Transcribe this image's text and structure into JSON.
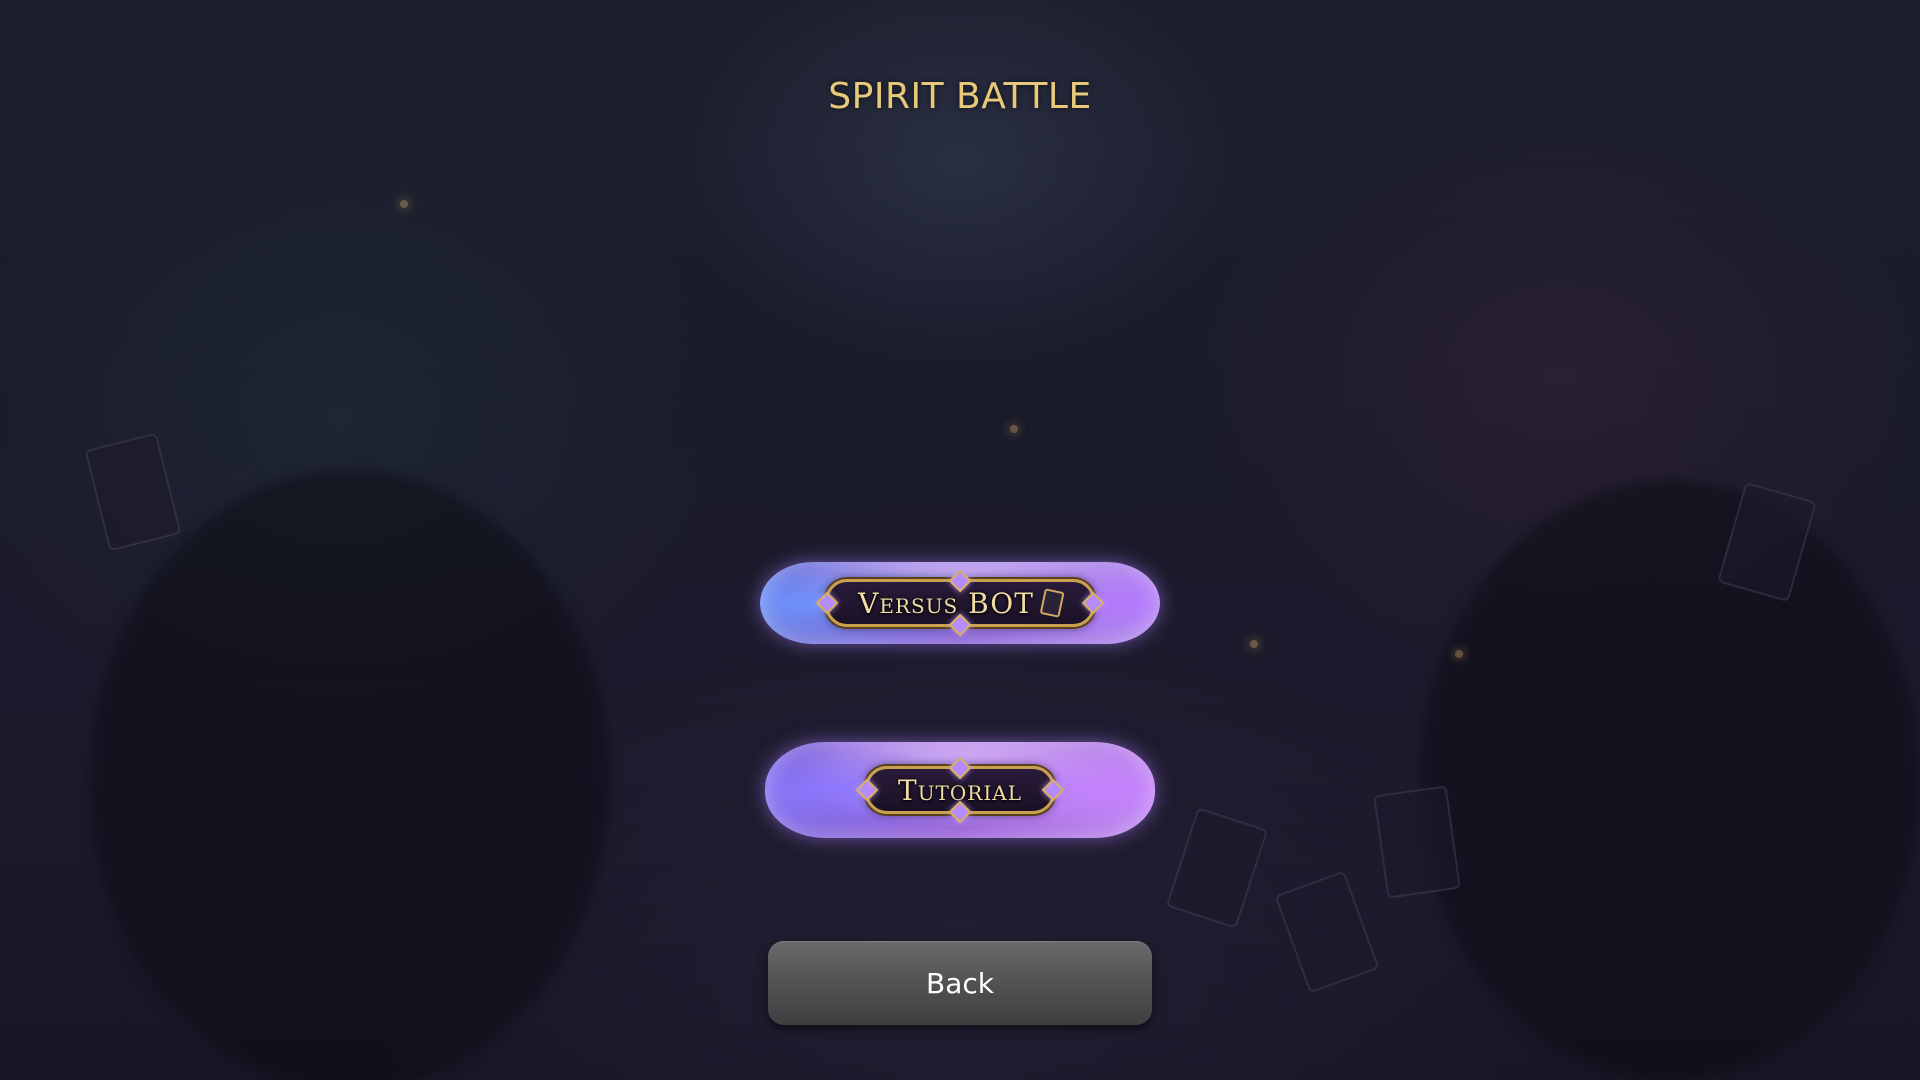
{
  "screen": {
    "title": "SPIRIT BATTLE"
  },
  "menu": {
    "versus_bot_label": "Versus BOT",
    "tutorial_label": "Tutorial",
    "back_label": "Back"
  },
  "colors": {
    "title": "#e7c979",
    "background": "#1a1b2b",
    "back_button": "#555557"
  }
}
